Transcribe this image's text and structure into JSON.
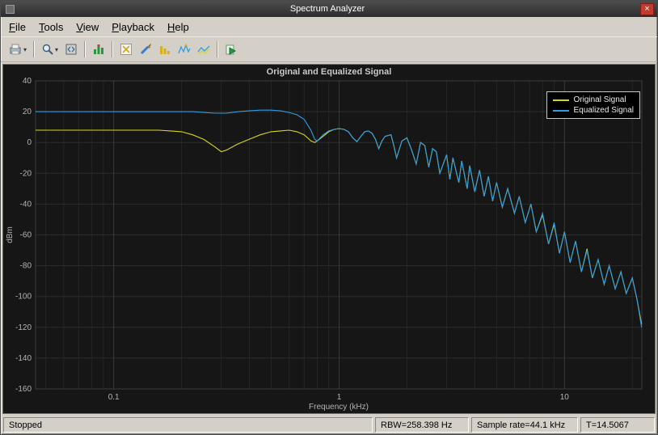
{
  "window": {
    "title": "Spectrum Analyzer",
    "close_glyph": "×"
  },
  "menubar": {
    "items": [
      {
        "label": "File"
      },
      {
        "label": "Tools"
      },
      {
        "label": "View"
      },
      {
        "label": "Playback"
      },
      {
        "label": "Help"
      }
    ]
  },
  "toolbar": {
    "icons": [
      "export-icon",
      "zoom-icon",
      "fit-to-view-icon",
      "spectrum-settings-icon",
      "cursor-measurements-icon",
      "distortion-measurements-icon",
      "ccdf-measurements-icon",
      "peak-finder-icon",
      "trace-selection-icon",
      "step-forward-icon"
    ]
  },
  "statusbar": {
    "state": "Stopped",
    "fields": [
      {
        "text": "RBW=258.398 Hz"
      },
      {
        "text": "Sample rate=44.1 kHz"
      },
      {
        "text": "T=14.5067"
      }
    ]
  },
  "colors": {
    "chrome": "#d4d0c8",
    "titlebar": "#3a3a3a",
    "close_button": "#c8382c",
    "plot_background": "#161616",
    "grid_minor": "#252525",
    "grid_major": "#3a3a3a",
    "axis_text": "#b4b4b4",
    "original_trace": "#d9d422",
    "equalized_trace": "#2f9ee6"
  },
  "chart_data": {
    "type": "line",
    "title": "Original and Equalized Signal",
    "xlabel": "Frequency (kHz)",
    "ylabel": "dBm",
    "x_scale": "log",
    "xlim": [
      0.045,
      22.05
    ],
    "ylim": [
      -160,
      40
    ],
    "y_ticks": [
      40,
      20,
      0,
      -20,
      -40,
      -60,
      -80,
      -100,
      -120,
      -140,
      -160
    ],
    "x_tick_labels": [
      {
        "value": 0.1,
        "label": "0.1"
      },
      {
        "value": 1,
        "label": "1"
      },
      {
        "value": 10,
        "label": "10"
      }
    ],
    "grid": true,
    "legend_position": "top-right",
    "x": [
      0.045,
      0.05,
      0.056,
      0.063,
      0.071,
      0.08,
      0.09,
      0.1,
      0.112,
      0.126,
      0.141,
      0.158,
      0.178,
      0.2,
      0.224,
      0.251,
      0.282,
      0.3,
      0.316,
      0.335,
      0.355,
      0.398,
      0.447,
      0.5,
      0.55,
      0.6,
      0.65,
      0.7,
      0.75,
      0.78,
      0.8,
      0.85,
      0.9,
      0.95,
      1.0,
      1.05,
      1.1,
      1.15,
      1.2,
      1.25,
      1.3,
      1.35,
      1.4,
      1.45,
      1.5,
      1.55,
      1.6,
      1.7,
      1.75,
      1.8,
      1.9,
      2.0,
      2.1,
      2.2,
      2.3,
      2.4,
      2.5,
      2.6,
      2.7,
      2.8,
      3.0,
      3.1,
      3.2,
      3.4,
      3.5,
      3.7,
      3.8,
      4.0,
      4.2,
      4.4,
      4.6,
      4.8,
      5.0,
      5.3,
      5.6,
      6.0,
      6.3,
      6.7,
      7.1,
      7.5,
      8.0,
      8.5,
      9.0,
      9.5,
      10.0,
      10.6,
      11.2,
      11.9,
      12.6,
      13.3,
      14.1,
      15.0,
      15.8,
      16.8,
      17.8,
      18.8,
      20.0,
      21.0,
      22.0
    ],
    "series": [
      {
        "name": "Original Signal",
        "color": "#d9d422",
        "values": [
          8,
          8,
          8,
          8,
          8,
          8,
          8,
          8,
          8,
          8,
          8,
          8,
          7.5,
          7,
          5,
          2,
          -3,
          -6,
          -5,
          -3,
          -1,
          2,
          5,
          7,
          7.5,
          8,
          7,
          5,
          1,
          0,
          1,
          4,
          7,
          8.5,
          9,
          8.5,
          7,
          3,
          0.5,
          4,
          7,
          7.5,
          6,
          2,
          -4,
          1,
          4,
          5,
          -2,
          -10,
          1,
          3,
          -5,
          -14,
          0,
          -2,
          -16,
          -4,
          -6,
          -20,
          -8,
          -24,
          -10,
          -26,
          -12,
          -30,
          -15,
          -32,
          -18,
          -35,
          -22,
          -38,
          -26,
          -42,
          -30,
          -46,
          -35,
          -52,
          -40,
          -58,
          -47,
          -66,
          -53,
          -72,
          -58,
          -78,
          -64,
          -84,
          -69,
          -88,
          -76,
          -92,
          -80,
          -95,
          -84,
          -98,
          -88,
          -102,
          -118
        ]
      },
      {
        "name": "Equalized Signal",
        "color": "#2f9ee6",
        "values": [
          20,
          20,
          20,
          20,
          20,
          20,
          20,
          20,
          20,
          20,
          20,
          20,
          20,
          20,
          20,
          19.5,
          19,
          19,
          19,
          19.5,
          20,
          20.5,
          21,
          21,
          20.5,
          19.5,
          18,
          15,
          8,
          2,
          1,
          5,
          7.5,
          8.5,
          9,
          8.5,
          7,
          3,
          0.5,
          4,
          7,
          7.5,
          6,
          2,
          -4,
          1,
          4,
          5,
          -2,
          -10,
          1,
          3,
          -5,
          -14,
          0,
          -2,
          -16,
          -4,
          -6,
          -20,
          -8,
          -24,
          -10,
          -26,
          -12,
          -30,
          -15,
          -32,
          -18,
          -35,
          -22,
          -38,
          -26,
          -42,
          -30,
          -46,
          -35,
          -52,
          -40,
          -58,
          -46,
          -66,
          -52,
          -72,
          -58,
          -78,
          -64,
          -84,
          -70,
          -88,
          -76,
          -92,
          -80,
          -95,
          -84,
          -98,
          -88,
          -102,
          -120
        ]
      }
    ]
  }
}
